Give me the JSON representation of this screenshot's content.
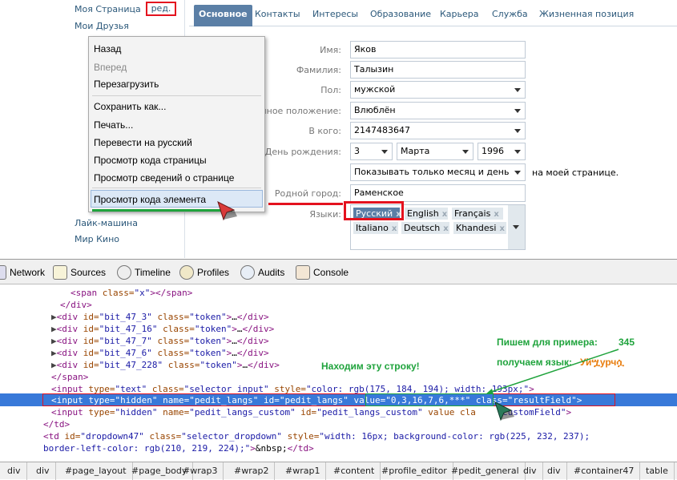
{
  "leftnav": {
    "my_page": "Моя Страница",
    "edit_badge": "ред.",
    "my_friends": "Мои Друзья",
    "item_hidden1": "Лайк-машина",
    "item_hidden2": "Мир Кино"
  },
  "tabs": [
    "Основное",
    "Контакты",
    "Интересы",
    "Образование",
    "Карьера",
    "Служба",
    "Жизненная позиция"
  ],
  "form": {
    "name_label": "Имя:",
    "name_value": "Яков",
    "surname_label": "Фамилия:",
    "surname_value": "Талызин",
    "sex_label": "Пол:",
    "sex_value": "мужской",
    "status_label": "ейное положение:",
    "status_value": "Влюблён",
    "partner_label": "В кого:",
    "partner_value": "2147483647",
    "bday_label": "День рождения:",
    "bday_day": "3",
    "bday_month": "Марта",
    "bday_year": "1996",
    "bday_show": "Показывать только месяц и день",
    "bday_suffix": "на моей странице.",
    "city_label": "Родной город:",
    "city_value": "Раменское",
    "langs_label": "Языки:",
    "langs": [
      "Русский",
      "English",
      "Français",
      "Italiano",
      "Deutsch",
      "Khandesi"
    ]
  },
  "context_menu": {
    "back": "Назад",
    "forward": "Вперед",
    "reload": "Перезагрузить",
    "save_as": "Сохранить как...",
    "print": "Печать...",
    "translate": "Перевести на русский",
    "view_source": "Просмотр кода страницы",
    "page_info": "Просмотр  сведений о странице",
    "inspect": "Просмотр кода элемента"
  },
  "devtools_tabs": [
    "Network",
    "Sources",
    "Timeline",
    "Profiles",
    "Audits",
    "Console"
  ],
  "code_lines": {
    "l1a": "<span",
    "l1b": " class=",
    "l1c": "\"x\"",
    "l1d": "></span>",
    "l2": "</div>",
    "d3a": "\"bit_47_3\"",
    "d3b": "\"token\"",
    "d16a": "\"bit_47_16\"",
    "d16b": "\"token\"",
    "d7a": "\"bit_47_7\"",
    "d7b": "\"token\"",
    "d6a": "\"bit_47_6\"",
    "d6b": "\"token\"",
    "d228a": "\"bit_47_228\"",
    "d228b": "\"token\"",
    "l8": "</span>",
    "in1_type": "\"text\"",
    "in1_class": "\"selector_input\"",
    "in1_style": "\"color: rgb(175, 184, 194); width: 193px;\"",
    "sel_type": "\"hidden\"",
    "sel_name": "\"pedit_langs\"",
    "sel_id": "\"pedit_langs\"",
    "sel_value": "\"0,3,16,7,6,***\"",
    "sel_class": "\"resultField\"",
    "in3_type": "\"hidden\"",
    "in3_name": "\"pedit_langs_custom\"",
    "in3_id": "\"pedit_langs_custom\"",
    "in3_value": "value",
    "in3_class_prefix": "cla",
    "in3_class": "\"customField\"",
    "td_close": "</td>",
    "td2_id": "\"dropdown47\"",
    "td2_class": "\"selector_dropdown\"",
    "td2_style1": "\"width: 16px; background-color: rgb(225, 232, 237);",
    "td2_style2": "border-left-color: rgb(210, 219, 224);\"",
    "td2_text": "&nbsp;",
    "td2_close": "</td>"
  },
  "annotations": {
    "find_row": "Находим эту строку!",
    "write_example": "Пишем для примера:",
    "write_value": "345",
    "get_lang": "получаем язык:",
    "lang_value": "Уйሧурчሷ"
  },
  "breadcrumbs": [
    "div",
    "div",
    "#page_layout",
    "#page_body",
    "#wrap3",
    "#wrap2",
    "#wrap1",
    "#content",
    "#profile_editor",
    "#pedit_general",
    "div",
    "div",
    "#container47",
    "table"
  ]
}
